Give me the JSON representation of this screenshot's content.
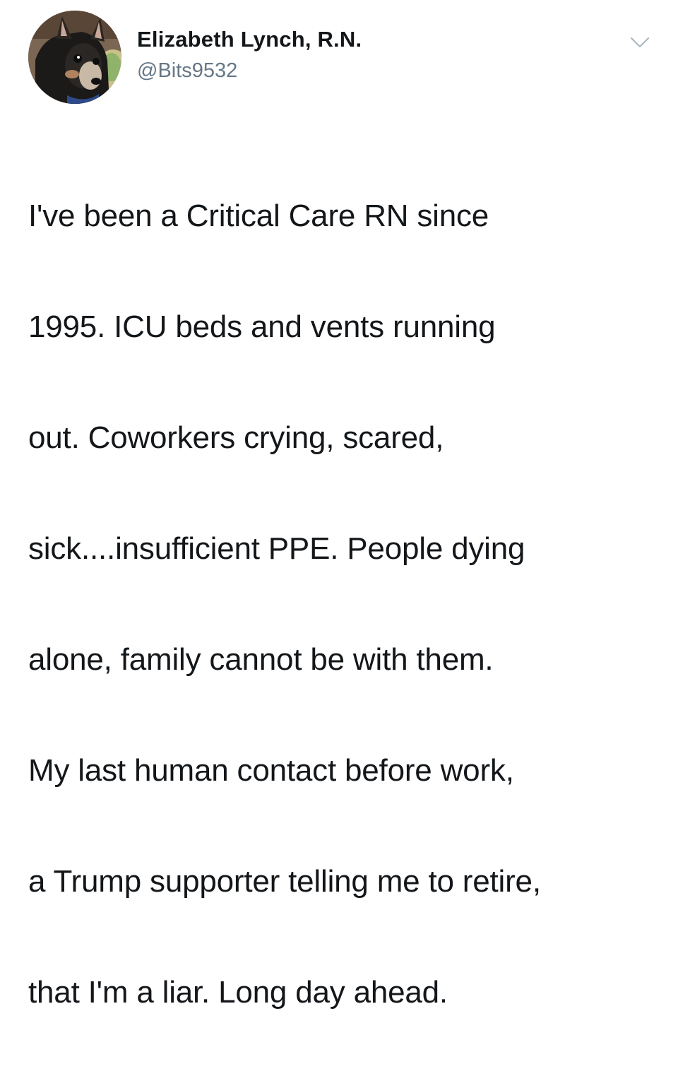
{
  "tweet": {
    "author": {
      "display_name": "Elizabeth Lynch, R.N.",
      "handle": "@Bits9532",
      "avatar": "dog-photo-avatar"
    },
    "menu_icon": "chevron-down-icon",
    "text_lines": [
      "I've been a Critical Care RN since",
      "1995. ICU beds and vents running",
      "out. Coworkers crying, scared,",
      "sick....insufficient PPE. People dying",
      "alone, family cannot be with them.",
      "My last human contact before work,",
      "a Trump supporter telling me to retire,",
      "that I'm a liar. Long day ahead."
    ]
  },
  "colors": {
    "text": "#14171a",
    "secondary": "#657786",
    "chevron": "#aab8c2",
    "background": "#ffffff"
  }
}
